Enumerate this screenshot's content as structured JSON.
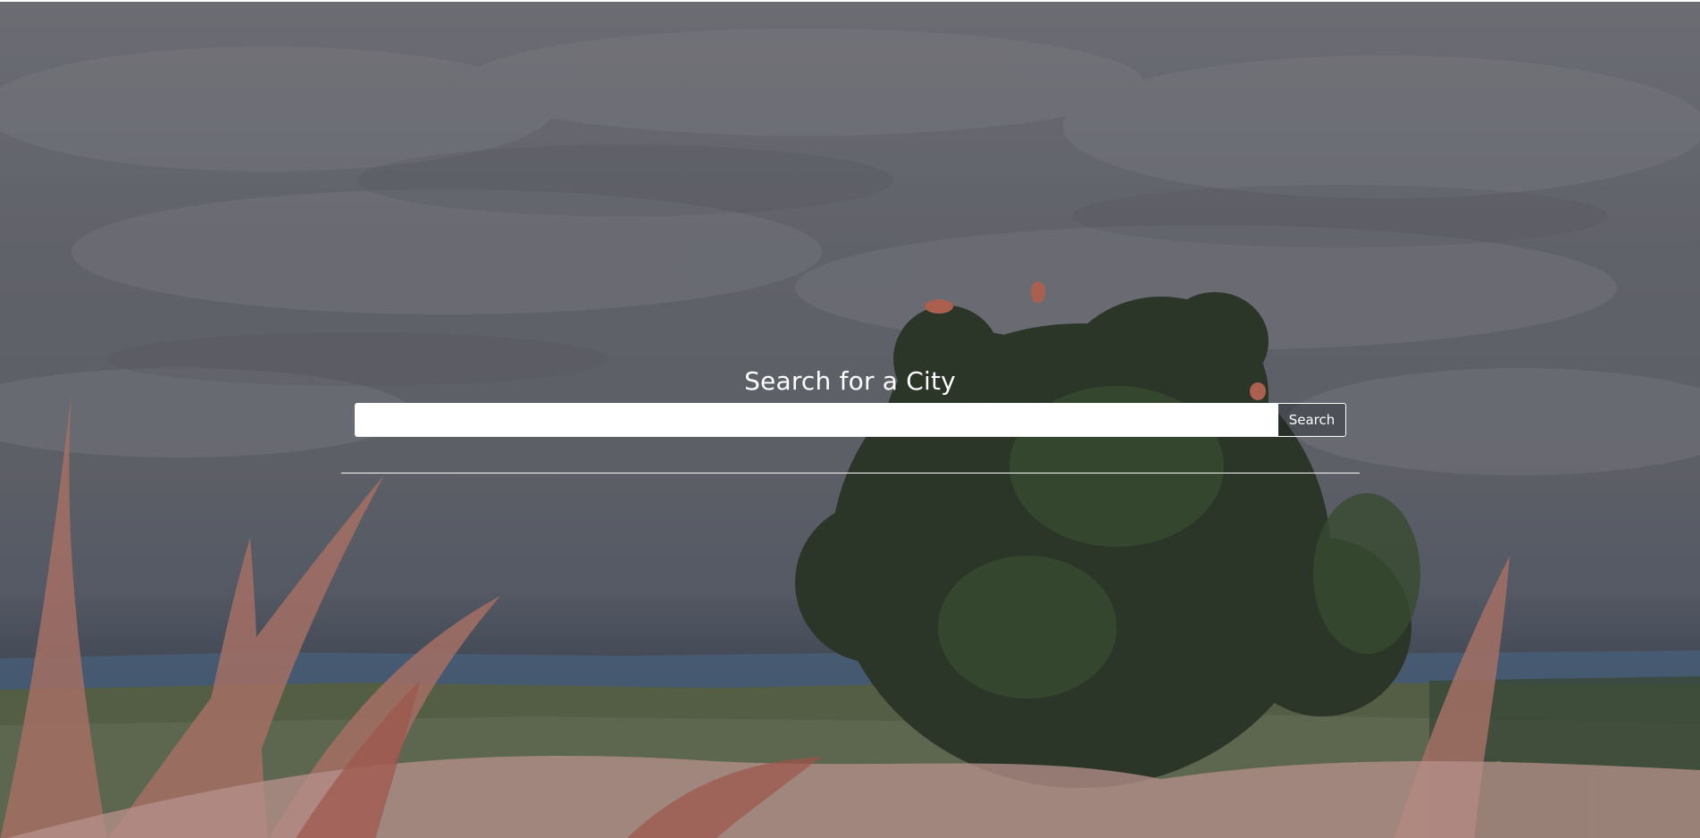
{
  "search": {
    "title": "Search for a City",
    "input_value": "",
    "input_placeholder": "",
    "button_label": "Search"
  },
  "background": {
    "subject": "cloudy-sky-landscape-with-shrub-and-grass-photo",
    "sky_color": "#7b7c82",
    "horizon_color": "#4f6a86",
    "foliage_color": "#2e3a2a",
    "grass_color": "#c98a7c"
  }
}
